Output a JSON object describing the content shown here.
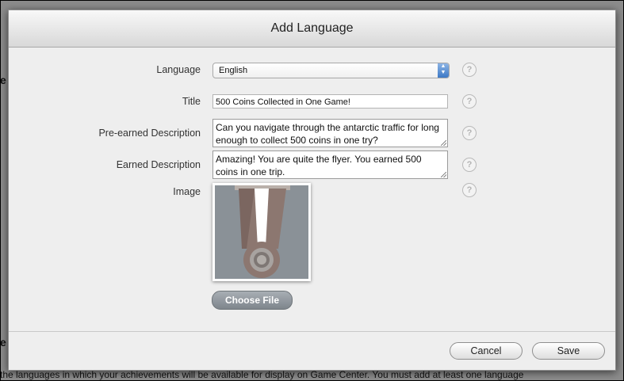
{
  "background": {
    "edge_chars": [
      "e",
      "e"
    ],
    "bottom_text": "the languages in which your achievements will be available for display on Game Center. You must add at least one language"
  },
  "dialog": {
    "title": "Add Language",
    "fields": {
      "language": {
        "label": "Language",
        "value": "English"
      },
      "title": {
        "label": "Title",
        "value": "500 Coins Collected in One Game!"
      },
      "pre_earned": {
        "label": "Pre-earned Description",
        "value": "Can you navigate through the antarctic traffic for long enough to collect 500 coins in one try?"
      },
      "earned": {
        "label": "Earned Description",
        "value": "Amazing! You are quite the flyer. You earned 500 coins in one trip."
      },
      "image": {
        "label": "Image"
      }
    },
    "help_glyph": "?",
    "choose_file_label": "Choose File",
    "footer": {
      "cancel_label": "Cancel",
      "save_label": "Save"
    }
  },
  "colors": {
    "medal_ribbon": "#8c7770",
    "medal_stripe": "#ffffff",
    "image_background": "#8a9197",
    "accent_blue": "#3d79c6"
  }
}
